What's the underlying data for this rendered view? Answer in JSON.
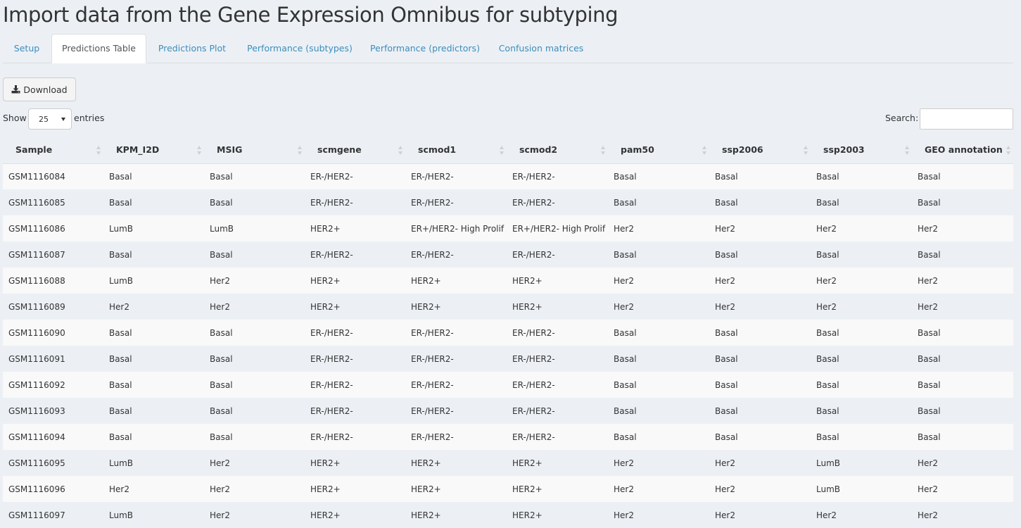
{
  "page": {
    "title": "Import data from the Gene Expression Omnibus for subtyping"
  },
  "tabs": [
    {
      "label": "Setup",
      "active": false
    },
    {
      "label": "Predictions Table",
      "active": true
    },
    {
      "label": "Predictions Plot",
      "active": false
    },
    {
      "label": "Performance (subtypes)",
      "active": false
    },
    {
      "label": "Performance (predictors)",
      "active": false
    },
    {
      "label": "Confusion matrices",
      "active": false
    }
  ],
  "toolbar": {
    "download_label": "Download",
    "download_icon": "download-icon"
  },
  "controls": {
    "show_label": "Show",
    "entries_per_page": "25",
    "entries_label": "entries",
    "search_label": "Search:",
    "search_value": ""
  },
  "table": {
    "columns": [
      "Sample",
      "KPM_I2D",
      "MSIG",
      "scmgene",
      "scmod1",
      "scmod2",
      "pam50",
      "ssp2006",
      "ssp2003",
      "GEO annotation"
    ],
    "rows": [
      [
        "GSM1116084",
        "Basal",
        "Basal",
        "ER-/HER2-",
        "ER-/HER2-",
        "ER-/HER2-",
        "Basal",
        "Basal",
        "Basal",
        "Basal"
      ],
      [
        "GSM1116085",
        "Basal",
        "Basal",
        "ER-/HER2-",
        "ER-/HER2-",
        "ER-/HER2-",
        "Basal",
        "Basal",
        "Basal",
        "Basal"
      ],
      [
        "GSM1116086",
        "LumB",
        "LumB",
        "HER2+",
        "ER+/HER2- High Prolif",
        "ER+/HER2- High Prolif",
        "Her2",
        "Her2",
        "Her2",
        "Her2"
      ],
      [
        "GSM1116087",
        "Basal",
        "Basal",
        "ER-/HER2-",
        "ER-/HER2-",
        "ER-/HER2-",
        "Basal",
        "Basal",
        "Basal",
        "Basal"
      ],
      [
        "GSM1116088",
        "LumB",
        "Her2",
        "HER2+",
        "HER2+",
        "HER2+",
        "Her2",
        "Her2",
        "Her2",
        "Her2"
      ],
      [
        "GSM1116089",
        "Her2",
        "Her2",
        "HER2+",
        "HER2+",
        "HER2+",
        "Her2",
        "Her2",
        "Her2",
        "Her2"
      ],
      [
        "GSM1116090",
        "Basal",
        "Basal",
        "ER-/HER2-",
        "ER-/HER2-",
        "ER-/HER2-",
        "Basal",
        "Basal",
        "Basal",
        "Basal"
      ],
      [
        "GSM1116091",
        "Basal",
        "Basal",
        "ER-/HER2-",
        "ER-/HER2-",
        "ER-/HER2-",
        "Basal",
        "Basal",
        "Basal",
        "Basal"
      ],
      [
        "GSM1116092",
        "Basal",
        "Basal",
        "ER-/HER2-",
        "ER-/HER2-",
        "ER-/HER2-",
        "Basal",
        "Basal",
        "Basal",
        "Basal"
      ],
      [
        "GSM1116093",
        "Basal",
        "Basal",
        "ER-/HER2-",
        "ER-/HER2-",
        "ER-/HER2-",
        "Basal",
        "Basal",
        "Basal",
        "Basal"
      ],
      [
        "GSM1116094",
        "Basal",
        "Basal",
        "ER-/HER2-",
        "ER-/HER2-",
        "ER-/HER2-",
        "Basal",
        "Basal",
        "Basal",
        "Basal"
      ],
      [
        "GSM1116095",
        "LumB",
        "Her2",
        "HER2+",
        "HER2+",
        "HER2+",
        "Her2",
        "Her2",
        "LumB",
        "Her2"
      ],
      [
        "GSM1116096",
        "Her2",
        "Her2",
        "HER2+",
        "HER2+",
        "HER2+",
        "Her2",
        "Her2",
        "LumB",
        "Her2"
      ],
      [
        "GSM1116097",
        "LumB",
        "Her2",
        "HER2+",
        "HER2+",
        "HER2+",
        "Her2",
        "Her2",
        "Her2",
        "Her2"
      ]
    ]
  },
  "colors": {
    "background": "#ecf0f5",
    "link": "#3c8dbc",
    "stripe": "#f9f9f9"
  }
}
